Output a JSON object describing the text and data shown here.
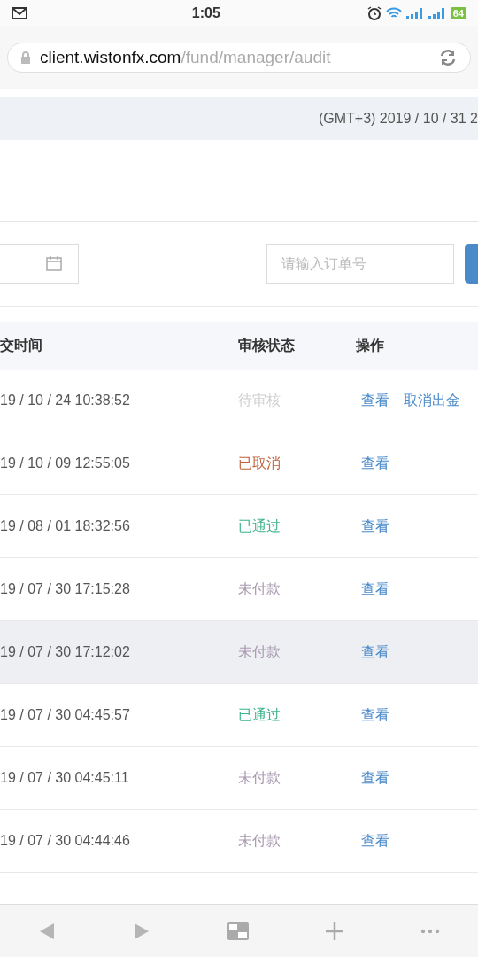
{
  "status_bar": {
    "time": "1:05",
    "battery": "64"
  },
  "address_bar": {
    "host": "client.wistonfx.com",
    "path": "/fund/manager/audit"
  },
  "server_time": "(GMT+3) 2019 / 10 / 31 2",
  "filters": {
    "order_placeholder": "请输入订单号"
  },
  "table": {
    "columns": [
      "交时间",
      "审核状态",
      "操作"
    ],
    "rows": [
      {
        "time": "19 / 10 / 24 10:38:52",
        "status": "待审核",
        "kind": "pending",
        "highlighted": false,
        "actions": [
          "查看",
          "取消出金"
        ]
      },
      {
        "time": "19 / 10 / 09 12:55:05",
        "status": "已取消",
        "kind": "cancelled",
        "highlighted": false,
        "actions": [
          "查看"
        ]
      },
      {
        "time": "19 / 08 / 01 18:32:56",
        "status": "已通过",
        "kind": "approved",
        "highlighted": false,
        "actions": [
          "查看"
        ]
      },
      {
        "time": "19 / 07 / 30 17:15:28",
        "status": "未付款",
        "kind": "unpaid",
        "highlighted": false,
        "actions": [
          "查看"
        ]
      },
      {
        "time": "19 / 07 / 30 17:12:02",
        "status": "未付款",
        "kind": "unpaid",
        "highlighted": true,
        "actions": [
          "查看"
        ]
      },
      {
        "time": "19 / 07 / 30 04:45:57",
        "status": "已通过",
        "kind": "approved",
        "highlighted": false,
        "actions": [
          "查看"
        ]
      },
      {
        "time": "19 / 07 / 30 04:45:11",
        "status": "未付款",
        "kind": "unpaid",
        "highlighted": false,
        "actions": [
          "查看"
        ]
      },
      {
        "time": "19 / 07 / 30 04:44:46",
        "status": "未付款",
        "kind": "unpaid",
        "highlighted": false,
        "actions": [
          "查看"
        ]
      }
    ]
  }
}
